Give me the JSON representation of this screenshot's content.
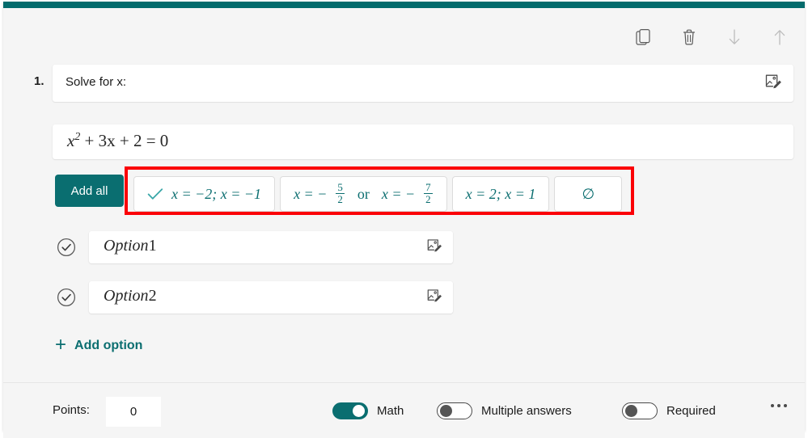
{
  "theme": {
    "accent": "#0a6e70",
    "top_bar": "#046b6c",
    "highlight_box": "#fb0007",
    "card_background": "#f5f5f5",
    "field_background": "#ffffff",
    "text": "#1b1b1b"
  },
  "toolbar": {
    "items": [
      {
        "name": "copy-question-button",
        "icon": "copy-icon",
        "enabled": true
      },
      {
        "name": "delete-question-button",
        "icon": "trash-icon",
        "enabled": true
      },
      {
        "name": "move-question-down-button",
        "icon": "arrow-down-icon",
        "enabled": false
      },
      {
        "name": "move-question-up-button",
        "icon": "arrow-up-icon",
        "enabled": false
      }
    ]
  },
  "question": {
    "number": "1.",
    "title": "Solve for x:",
    "title_placeholder": "Enter your question",
    "image_icon": "insert-image-icon",
    "equation": {
      "base": "x",
      "exponent": "2",
      "rest": "+ 3x + 2 = 0",
      "plain": "x^2 + 3x + 2 = 0"
    }
  },
  "suggestions": {
    "add_all_label": "Add all",
    "highlighted": true,
    "chips": [
      {
        "id": "suggestion-1",
        "selected": true,
        "check_icon": "checkmark-icon",
        "kind": "plain",
        "text": "x = −2; x = −1"
      },
      {
        "id": "suggestion-2",
        "selected": false,
        "kind": "fraction",
        "lhs": "x = −",
        "frac1_num": "5",
        "frac1_den": "2",
        "conjunction": "or",
        "mid": "x = −",
        "frac2_num": "7",
        "frac2_den": "2",
        "text": "x = −5/2 or x = −7/2"
      },
      {
        "id": "suggestion-3",
        "selected": false,
        "kind": "plain",
        "text": "x = 2; x = 1"
      },
      {
        "id": "suggestion-4",
        "selected": false,
        "kind": "plain",
        "text": "∅"
      }
    ]
  },
  "options": [
    {
      "id": "option-1",
      "check_icon": "check-circle-icon",
      "word": "Option",
      "number": "1",
      "image_icon": "insert-image-icon"
    },
    {
      "id": "option-2",
      "check_icon": "check-circle-icon",
      "word": "Option",
      "number": "2",
      "image_icon": "insert-image-icon"
    }
  ],
  "add_option": {
    "plus": "+",
    "label": "Add option"
  },
  "footer": {
    "points_label": "Points:",
    "points_value": "0",
    "toggles": [
      {
        "id": "math-toggle",
        "label": "Math",
        "on": true
      },
      {
        "id": "multiple-answers-toggle",
        "label": "Multiple answers",
        "on": false
      },
      {
        "id": "required-toggle",
        "label": "Required",
        "on": false
      }
    ],
    "more_icon": "ellipsis-icon"
  }
}
